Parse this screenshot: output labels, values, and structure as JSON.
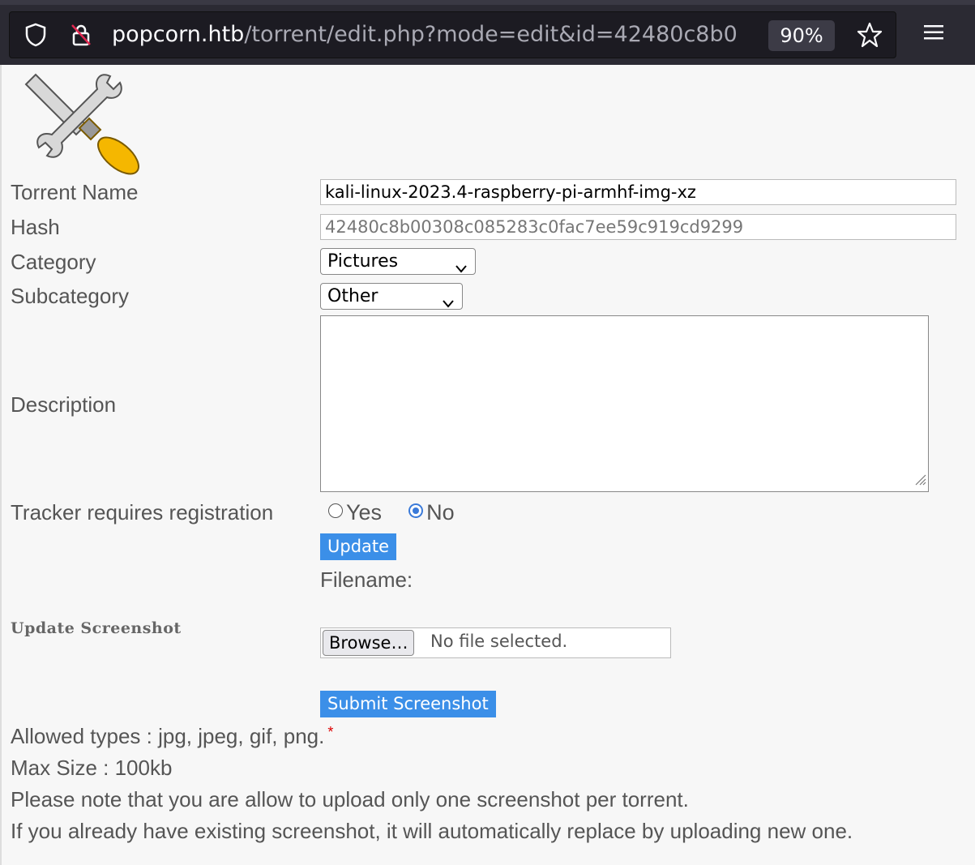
{
  "browser": {
    "url_host": "popcorn.htb",
    "url_path": "/torrent/edit.php?mode=edit&id=42480c8b0",
    "zoom": "90%"
  },
  "form": {
    "torrent_name_label": "Torrent Name",
    "torrent_name_value": "kali-linux-2023.4-raspberry-pi-armhf-img-xz",
    "hash_label": "Hash",
    "hash_value": "42480c8b00308c085283c0fac7ee59c919cd9299",
    "category_label": "Category",
    "category_value": "Pictures",
    "subcategory_label": "Subcategory",
    "subcategory_value": "Other",
    "description_label": "Description",
    "tracker_label": "Tracker requires registration",
    "tracker_yes": "Yes",
    "tracker_no": "No",
    "tracker_selected": "No",
    "update_button": "Update",
    "filename_label": "Filename:"
  },
  "screenshot": {
    "section_label": "Update Screenshot",
    "browse_button": "Browse…",
    "no_file": "No file selected.",
    "submit_button": "Submit Screenshot",
    "allowed_types": "Allowed types : jpg, jpeg, gif, png.",
    "required_mark": "*",
    "max_size": "Max Size : 100kb",
    "note1": "Please note that you are allow to upload only one screenshot per torrent.",
    "note2": "If you already have existing screenshot, it will automatically replace by uploading new one."
  }
}
